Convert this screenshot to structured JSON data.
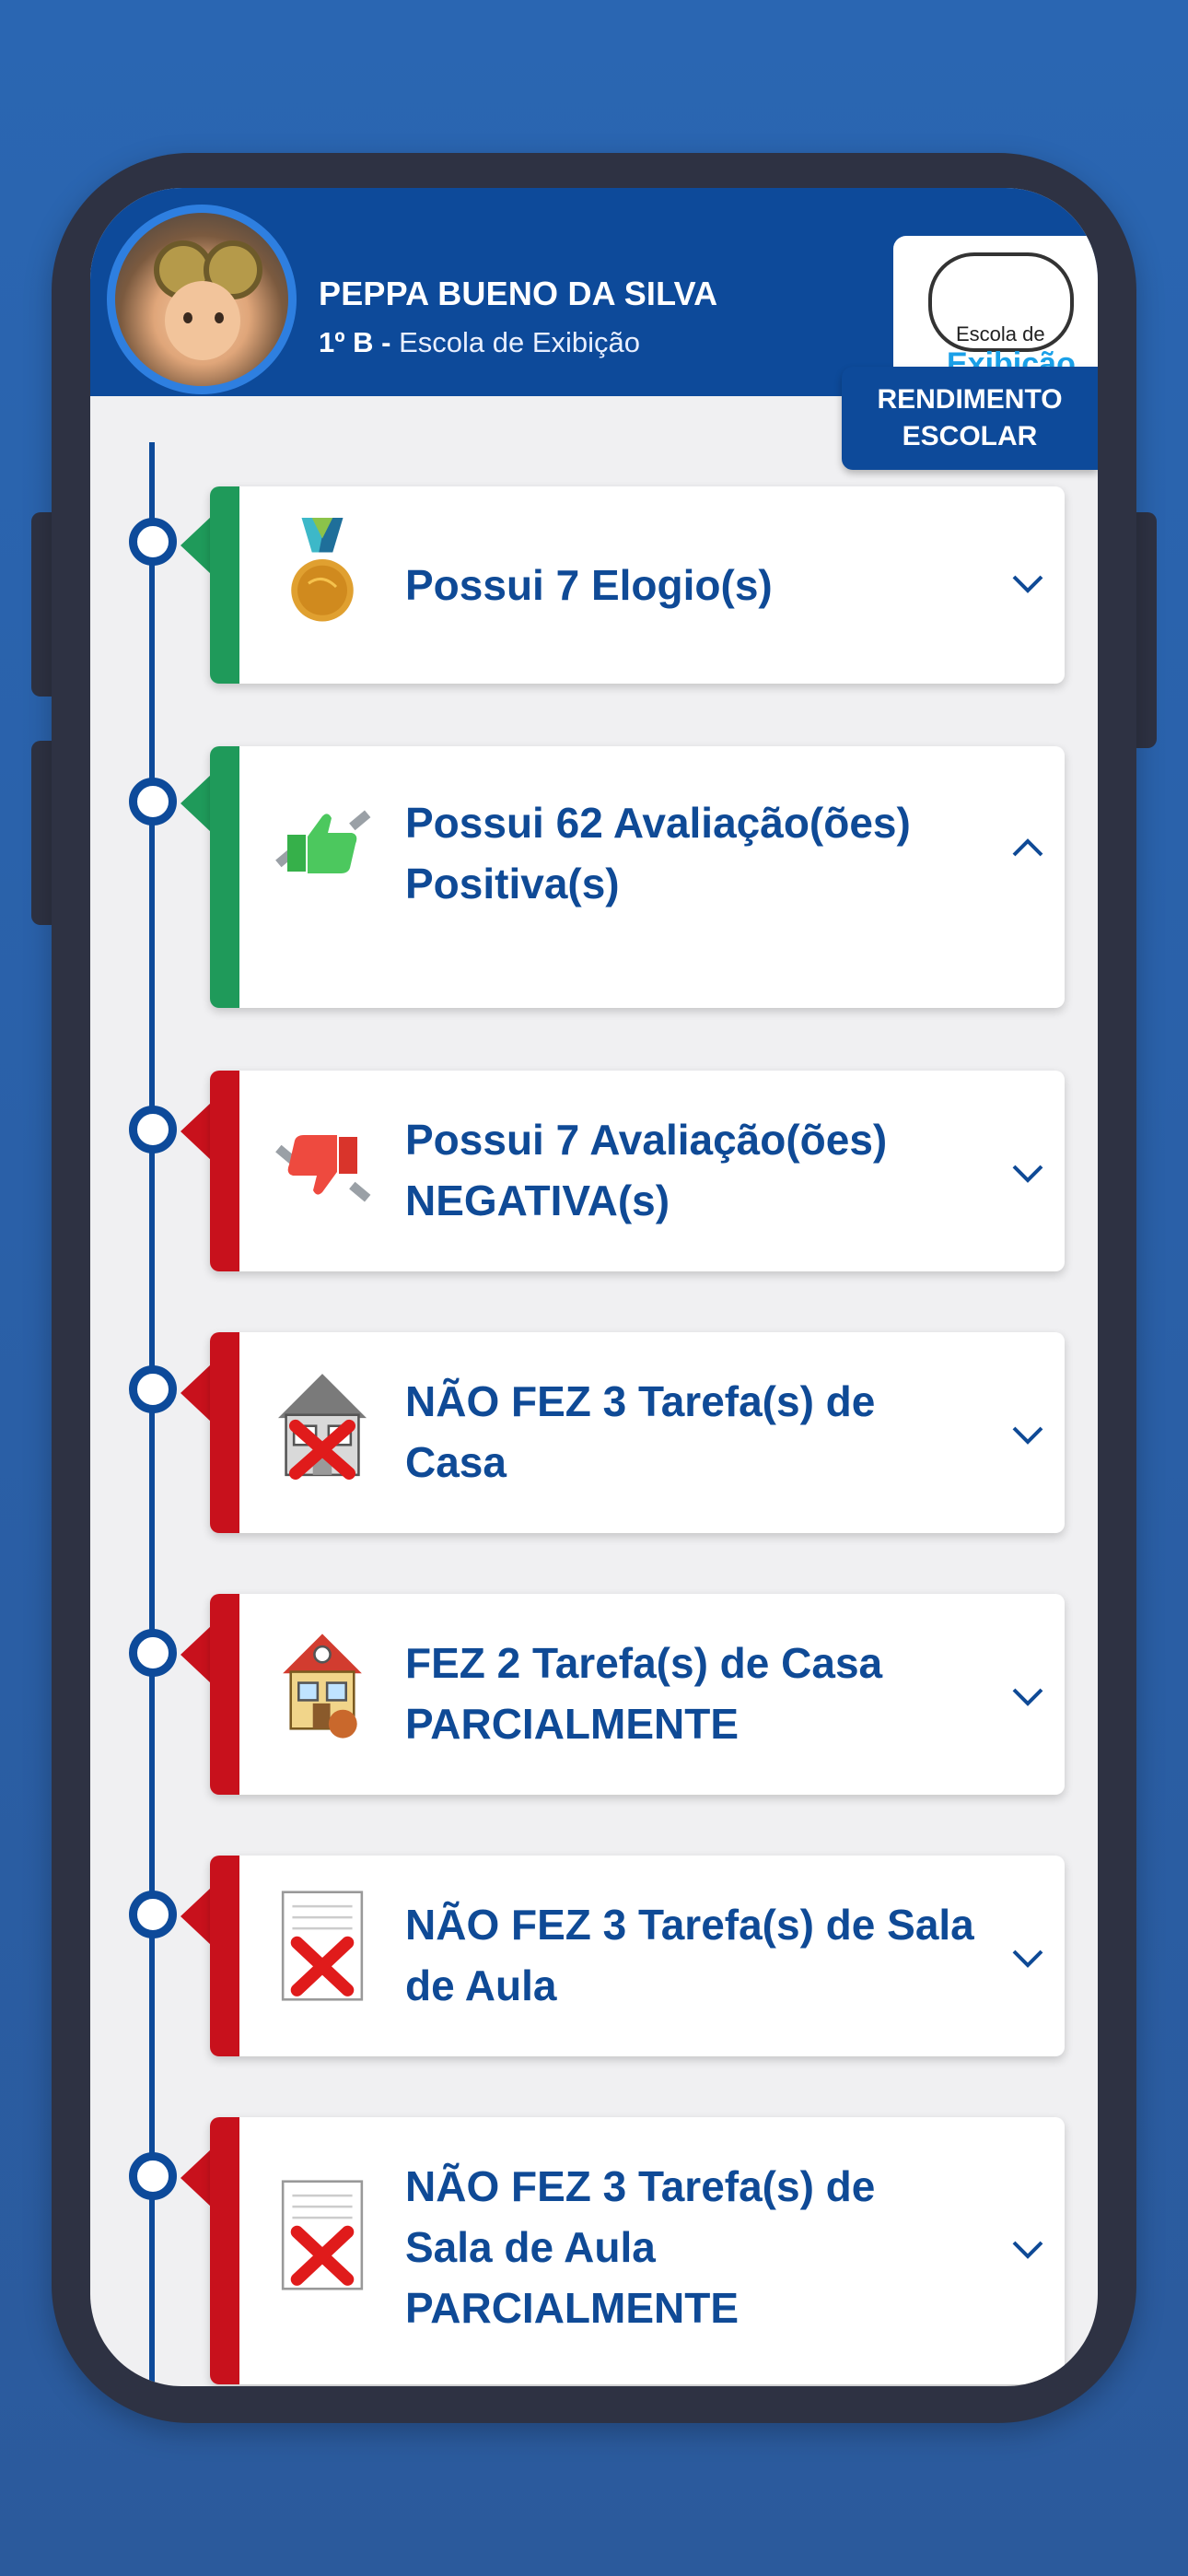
{
  "student": {
    "name": "PEPPA BUENO DA SILVA",
    "class": "1º B -",
    "school": " Escola de Exibição"
  },
  "school_logo": {
    "line1": "Escola de",
    "line2": "Exibição"
  },
  "rendimento_button": {
    "line1": "RENDIMENTO",
    "line2": "ESCOLAR"
  },
  "colors": {
    "header": "#0d4a9a",
    "positive": "#1f9a5a",
    "negative": "#c8111c",
    "text": "#0f4a96"
  },
  "items": [
    {
      "title": "Possui 7 Elogio(s)",
      "icon": "medal-icon",
      "status": "positive",
      "expanded": false
    },
    {
      "title": "Possui 62 Avaliação(ões) Positiva(s)",
      "icon": "thumbs-up-icon",
      "status": "positive",
      "expanded": true
    },
    {
      "title": "Possui 7 Avaliação(ões) NEGATIVA(s)",
      "icon": "thumbs-down-icon",
      "status": "negative",
      "expanded": false
    },
    {
      "title": "NÃO FEZ 3 Tarefa(s) de Casa",
      "icon": "house-x-icon",
      "status": "negative",
      "expanded": false
    },
    {
      "title": "FEZ 2 Tarefa(s) de Casa PARCIALMENTE",
      "icon": "house-partial-icon",
      "status": "negative",
      "expanded": false
    },
    {
      "title": "NÃO FEZ 3 Tarefa(s) de Sala de Aula",
      "icon": "document-x-icon",
      "status": "negative",
      "expanded": false
    },
    {
      "title": "NÃO FEZ 3 Tarefa(s) de Sala de Aula PARCIALMENTE",
      "icon": "document-x-icon",
      "status": "negative",
      "expanded": false
    }
  ]
}
